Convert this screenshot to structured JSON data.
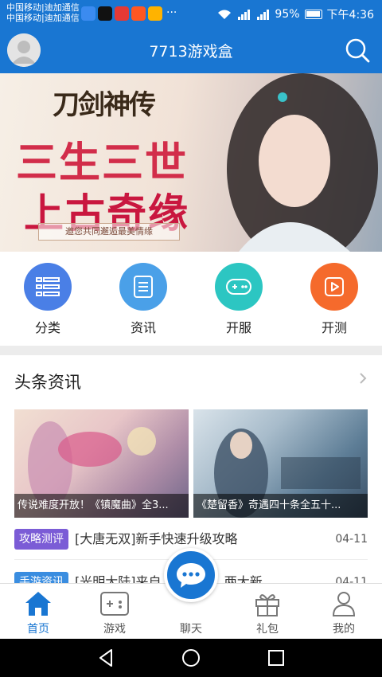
{
  "status_bar": {
    "carrier_line1": "中国移动|迪加通信",
    "carrier_line2": "中国移动|迪加通信",
    "more": "···",
    "battery": "95%",
    "time": "下午4:36"
  },
  "header": {
    "title": "7713游戏盒"
  },
  "banner": {
    "logo_text": "刀剑神传",
    "line1": "三生三世",
    "line2": "上古奇缘",
    "sub": "邀您共同邂逅最美情缘"
  },
  "quick_nav": [
    {
      "label": "分类",
      "color": "#4a7fe6"
    },
    {
      "label": "资讯",
      "color": "#4aa0e8"
    },
    {
      "label": "开服",
      "color": "#2cc6c2"
    },
    {
      "label": "开测",
      "color": "#f56a2c"
    }
  ],
  "section": {
    "title": "头条资讯"
  },
  "cards": [
    {
      "caption": "传说难度开放！《镇魔曲》全3..."
    },
    {
      "caption": "《楚留香》奇遇四十条全五十..."
    }
  ],
  "news": [
    {
      "badge": "攻略测评",
      "badge_color": "#7b5cd6",
      "title": "[大唐无双]新手快速升级攻略",
      "date": "04-11"
    },
    {
      "badge": "手游资讯",
      "badge_color": "#3a8de0",
      "title": "[光明大陆]来自...周年信：两大新...",
      "date": "04-11"
    }
  ],
  "tabbar": [
    {
      "label": "首页",
      "icon": "home-icon",
      "active": true
    },
    {
      "label": "游戏",
      "icon": "gamepad-icon",
      "active": false
    },
    {
      "label": "聊天",
      "icon": "chat-icon",
      "active": false
    },
    {
      "label": "礼包",
      "icon": "gift-icon",
      "active": false
    },
    {
      "label": "我的",
      "icon": "user-icon",
      "active": false
    }
  ],
  "colors": {
    "primary": "#1976d2"
  }
}
